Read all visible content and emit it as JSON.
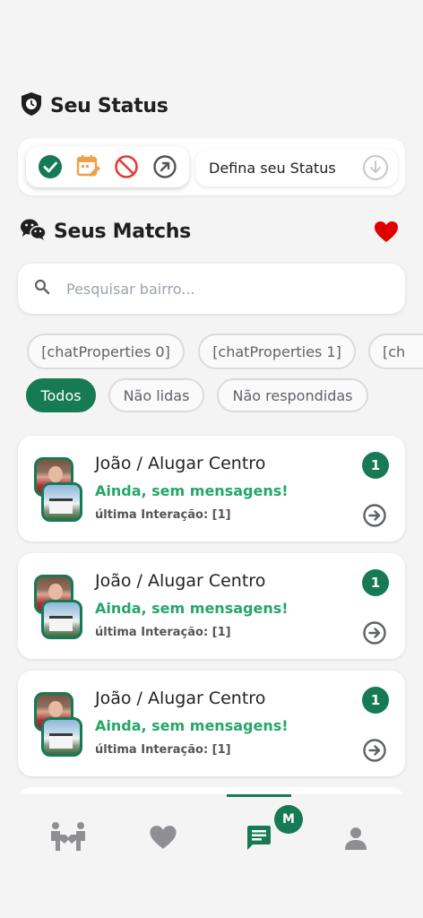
{
  "status_section": {
    "title": "Seu Status",
    "select_label": "Defina seu Status",
    "icons": [
      "check-circle-icon",
      "calendar-edit-icon",
      "block-icon",
      "arrow-up-right-circle-icon"
    ],
    "colors": {
      "check": "#167a55",
      "calendar": "#f0a04b",
      "block": "#e53935",
      "arrow": "#555555"
    }
  },
  "matchs_section": {
    "title": "Seus Matchs",
    "heart_color": "#e00000"
  },
  "search": {
    "placeholder": "Pesquisar bairro..."
  },
  "property_chips": [
    "[chatProperties 0]",
    "[chatProperties 1]",
    "[ch"
  ],
  "filters": [
    {
      "label": "Todos",
      "active": true
    },
    {
      "label": "Não lidas",
      "active": false
    },
    {
      "label": "Não respondidas",
      "active": false
    }
  ],
  "matches": [
    {
      "title": "João / Alugar Centro",
      "message": "Ainda, sem mensagens!",
      "last_interaction": "última Interação: [1]",
      "unread": "1"
    },
    {
      "title": "João / Alugar Centro",
      "message": "Ainda, sem mensagens!",
      "last_interaction": "última Interação: [1]",
      "unread": "1"
    },
    {
      "title": "João / Alugar Centro",
      "message": "Ainda, sem mensagens!",
      "last_interaction": "última Interação: [1]",
      "unread": "1"
    }
  ],
  "bottom_nav": {
    "items": [
      "handshake-icon",
      "heart-icon",
      "chat-icon",
      "profile-icon"
    ],
    "active": "chat-icon",
    "badge": "M",
    "accent": "#167a55"
  }
}
